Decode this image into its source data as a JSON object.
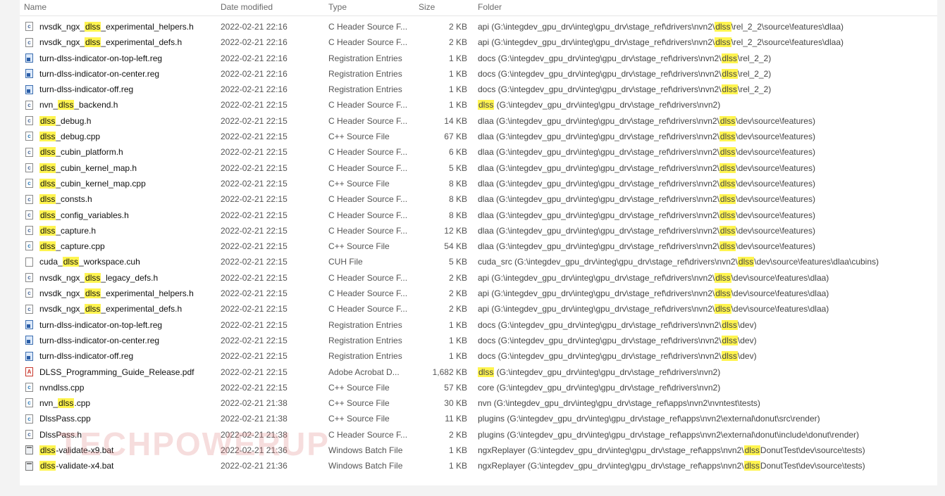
{
  "columns": {
    "name": "Name",
    "date": "Date modified",
    "type": "Type",
    "size": "Size",
    "folder": "Folder"
  },
  "highlight_color": "#fff44f",
  "watermark": "TECHPOWERUP",
  "rows": [
    {
      "icon": "h",
      "name_pre": "nvsdk_ngx_",
      "name_hl": "dlss",
      "name_post": "_experimental_helpers.h",
      "date": "2022-02-21 22:16",
      "type": "C Header Source F...",
      "size": "2 KB",
      "folder_pre": "api (G:\\integdev_gpu_drv\\integ\\gpu_drv\\stage_ref\\drivers\\nvn2\\",
      "folder_hl": "dlss",
      "folder_post": "\\rel_2_2\\source\\features\\dlaa)"
    },
    {
      "icon": "h",
      "name_pre": "nvsdk_ngx_",
      "name_hl": "dlss",
      "name_post": "_experimental_defs.h",
      "date": "2022-02-21 22:16",
      "type": "C Header Source F...",
      "size": "2 KB",
      "folder_pre": "api (G:\\integdev_gpu_drv\\integ\\gpu_drv\\stage_ref\\drivers\\nvn2\\",
      "folder_hl": "dlss",
      "folder_post": "\\rel_2_2\\source\\features\\dlaa)"
    },
    {
      "icon": "reg",
      "name_pre": "turn-dlss-indicator-on-top-left.reg",
      "name_hl": "",
      "name_post": "",
      "date": "2022-02-21 22:16",
      "type": "Registration Entries",
      "size": "1 KB",
      "folder_pre": "docs (G:\\integdev_gpu_drv\\integ\\gpu_drv\\stage_ref\\drivers\\nvn2\\",
      "folder_hl": "dlss",
      "folder_post": "\\rel_2_2)"
    },
    {
      "icon": "reg",
      "name_pre": "turn-dlss-indicator-on-center.reg",
      "name_hl": "",
      "name_post": "",
      "date": "2022-02-21 22:16",
      "type": "Registration Entries",
      "size": "1 KB",
      "folder_pre": "docs (G:\\integdev_gpu_drv\\integ\\gpu_drv\\stage_ref\\drivers\\nvn2\\",
      "folder_hl": "dlss",
      "folder_post": "\\rel_2_2)"
    },
    {
      "icon": "reg",
      "name_pre": "turn-dlss-indicator-off.reg",
      "name_hl": "",
      "name_post": "",
      "date": "2022-02-21 22:16",
      "type": "Registration Entries",
      "size": "1 KB",
      "folder_pre": "docs (G:\\integdev_gpu_drv\\integ\\gpu_drv\\stage_ref\\drivers\\nvn2\\",
      "folder_hl": "dlss",
      "folder_post": "\\rel_2_2)"
    },
    {
      "icon": "h",
      "name_pre": "nvn_",
      "name_hl": "dlss",
      "name_post": "_backend.h",
      "date": "2022-02-21 22:15",
      "type": "C Header Source F...",
      "size": "1 KB",
      "folder_pre": "",
      "folder_hl": "dlss",
      "folder_post": " (G:\\integdev_gpu_drv\\integ\\gpu_drv\\stage_ref\\drivers\\nvn2)"
    },
    {
      "icon": "h",
      "name_pre": "",
      "name_hl": "dlss",
      "name_post": "_debug.h",
      "date": "2022-02-21 22:15",
      "type": "C Header Source F...",
      "size": "14 KB",
      "folder_pre": "dlaa (G:\\integdev_gpu_drv\\integ\\gpu_drv\\stage_ref\\drivers\\nvn2\\",
      "folder_hl": "dlss",
      "folder_post": "\\dev\\source\\features)"
    },
    {
      "icon": "cpp",
      "name_pre": "",
      "name_hl": "dlss",
      "name_post": "_debug.cpp",
      "date": "2022-02-21 22:15",
      "type": "C++ Source File",
      "size": "67 KB",
      "folder_pre": "dlaa (G:\\integdev_gpu_drv\\integ\\gpu_drv\\stage_ref\\drivers\\nvn2\\",
      "folder_hl": "dlss",
      "folder_post": "\\dev\\source\\features)"
    },
    {
      "icon": "h",
      "name_pre": "",
      "name_hl": "dlss",
      "name_post": "_cubin_platform.h",
      "date": "2022-02-21 22:15",
      "type": "C Header Source F...",
      "size": "6 KB",
      "folder_pre": "dlaa (G:\\integdev_gpu_drv\\integ\\gpu_drv\\stage_ref\\drivers\\nvn2\\",
      "folder_hl": "dlss",
      "folder_post": "\\dev\\source\\features)"
    },
    {
      "icon": "h",
      "name_pre": "",
      "name_hl": "dlss",
      "name_post": "_cubin_kernel_map.h",
      "date": "2022-02-21 22:15",
      "type": "C Header Source F...",
      "size": "5 KB",
      "folder_pre": "dlaa (G:\\integdev_gpu_drv\\integ\\gpu_drv\\stage_ref\\drivers\\nvn2\\",
      "folder_hl": "dlss",
      "folder_post": "\\dev\\source\\features)"
    },
    {
      "icon": "cpp",
      "name_pre": "",
      "name_hl": "dlss",
      "name_post": "_cubin_kernel_map.cpp",
      "date": "2022-02-21 22:15",
      "type": "C++ Source File",
      "size": "8 KB",
      "folder_pre": "dlaa (G:\\integdev_gpu_drv\\integ\\gpu_drv\\stage_ref\\drivers\\nvn2\\",
      "folder_hl": "dlss",
      "folder_post": "\\dev\\source\\features)"
    },
    {
      "icon": "h",
      "name_pre": "",
      "name_hl": "dlss",
      "name_post": "_consts.h",
      "date": "2022-02-21 22:15",
      "type": "C Header Source F...",
      "size": "8 KB",
      "folder_pre": "dlaa (G:\\integdev_gpu_drv\\integ\\gpu_drv\\stage_ref\\drivers\\nvn2\\",
      "folder_hl": "dlss",
      "folder_post": "\\dev\\source\\features)"
    },
    {
      "icon": "h",
      "name_pre": "",
      "name_hl": "dlss",
      "name_post": "_config_variables.h",
      "date": "2022-02-21 22:15",
      "type": "C Header Source F...",
      "size": "8 KB",
      "folder_pre": "dlaa (G:\\integdev_gpu_drv\\integ\\gpu_drv\\stage_ref\\drivers\\nvn2\\",
      "folder_hl": "dlss",
      "folder_post": "\\dev\\source\\features)"
    },
    {
      "icon": "h",
      "name_pre": "",
      "name_hl": "dlss",
      "name_post": "_capture.h",
      "date": "2022-02-21 22:15",
      "type": "C Header Source F...",
      "size": "12 KB",
      "folder_pre": "dlaa (G:\\integdev_gpu_drv\\integ\\gpu_drv\\stage_ref\\drivers\\nvn2\\",
      "folder_hl": "dlss",
      "folder_post": "\\dev\\source\\features)"
    },
    {
      "icon": "cpp",
      "name_pre": "",
      "name_hl": "dlss",
      "name_post": "_capture.cpp",
      "date": "2022-02-21 22:15",
      "type": "C++ Source File",
      "size": "54 KB",
      "folder_pre": "dlaa (G:\\integdev_gpu_drv\\integ\\gpu_drv\\stage_ref\\drivers\\nvn2\\",
      "folder_hl": "dlss",
      "folder_post": "\\dev\\source\\features)"
    },
    {
      "icon": "cuh",
      "name_pre": "cuda_",
      "name_hl": "dlss",
      "name_post": "_workspace.cuh",
      "date": "2022-02-21 22:15",
      "type": "CUH File",
      "size": "5 KB",
      "folder_pre": "cuda_src (G:\\integdev_gpu_drv\\integ\\gpu_drv\\stage_ref\\drivers\\nvn2\\",
      "folder_hl": "dlss",
      "folder_post": "\\dev\\source\\features\\dlaa\\cubins)"
    },
    {
      "icon": "h",
      "name_pre": "nvsdk_ngx_",
      "name_hl": "dlss",
      "name_post": "_legacy_defs.h",
      "date": "2022-02-21 22:15",
      "type": "C Header Source F...",
      "size": "2 KB",
      "folder_pre": "api (G:\\integdev_gpu_drv\\integ\\gpu_drv\\stage_ref\\drivers\\nvn2\\",
      "folder_hl": "dlss",
      "folder_post": "\\dev\\source\\features\\dlaa)"
    },
    {
      "icon": "h",
      "name_pre": "nvsdk_ngx_",
      "name_hl": "dlss",
      "name_post": "_experimental_helpers.h",
      "date": "2022-02-21 22:15",
      "type": "C Header Source F...",
      "size": "2 KB",
      "folder_pre": "api (G:\\integdev_gpu_drv\\integ\\gpu_drv\\stage_ref\\drivers\\nvn2\\",
      "folder_hl": "dlss",
      "folder_post": "\\dev\\source\\features\\dlaa)"
    },
    {
      "icon": "h",
      "name_pre": "nvsdk_ngx_",
      "name_hl": "dlss",
      "name_post": "_experimental_defs.h",
      "date": "2022-02-21 22:15",
      "type": "C Header Source F...",
      "size": "2 KB",
      "folder_pre": "api (G:\\integdev_gpu_drv\\integ\\gpu_drv\\stage_ref\\drivers\\nvn2\\",
      "folder_hl": "dlss",
      "folder_post": "\\dev\\source\\features\\dlaa)"
    },
    {
      "icon": "reg",
      "name_pre": "turn-dlss-indicator-on-top-left.reg",
      "name_hl": "",
      "name_post": "",
      "date": "2022-02-21 22:15",
      "type": "Registration Entries",
      "size": "1 KB",
      "folder_pre": "docs (G:\\integdev_gpu_drv\\integ\\gpu_drv\\stage_ref\\drivers\\nvn2\\",
      "folder_hl": "dlss",
      "folder_post": "\\dev)"
    },
    {
      "icon": "reg",
      "name_pre": "turn-dlss-indicator-on-center.reg",
      "name_hl": "",
      "name_post": "",
      "date": "2022-02-21 22:15",
      "type": "Registration Entries",
      "size": "1 KB",
      "folder_pre": "docs (G:\\integdev_gpu_drv\\integ\\gpu_drv\\stage_ref\\drivers\\nvn2\\",
      "folder_hl": "dlss",
      "folder_post": "\\dev)"
    },
    {
      "icon": "reg",
      "name_pre": "turn-dlss-indicator-off.reg",
      "name_hl": "",
      "name_post": "",
      "date": "2022-02-21 22:15",
      "type": "Registration Entries",
      "size": "1 KB",
      "folder_pre": "docs (G:\\integdev_gpu_drv\\integ\\gpu_drv\\stage_ref\\drivers\\nvn2\\",
      "folder_hl": "dlss",
      "folder_post": "\\dev)"
    },
    {
      "icon": "pdf",
      "name_pre": "DLSS_Programming_Guide_Release.pdf",
      "name_hl": "",
      "name_post": "",
      "date": "2022-02-21 22:15",
      "type": "Adobe Acrobat D...",
      "size": "1,682 KB",
      "folder_pre": "",
      "folder_hl": "dlss",
      "folder_post": " (G:\\integdev_gpu_drv\\integ\\gpu_drv\\stage_ref\\drivers\\nvn2)"
    },
    {
      "icon": "cpp",
      "name_pre": "nvndlss.cpp",
      "name_hl": "",
      "name_post": "",
      "date": "2022-02-21 22:15",
      "type": "C++ Source File",
      "size": "57 KB",
      "folder_pre": "core (G:\\integdev_gpu_drv\\integ\\gpu_drv\\stage_ref\\drivers\\nvn2)",
      "folder_hl": "",
      "folder_post": ""
    },
    {
      "icon": "cpp",
      "name_pre": "nvn_",
      "name_hl": "dlss",
      "name_post": ".cpp",
      "date": "2022-02-21 21:38",
      "type": "C++ Source File",
      "size": "30 KB",
      "folder_pre": "nvn (G:\\integdev_gpu_drv\\integ\\gpu_drv\\stage_ref\\apps\\nvn2\\nvntest\\tests)",
      "folder_hl": "",
      "folder_post": ""
    },
    {
      "icon": "cpp",
      "name_pre": "DlssPass.cpp",
      "name_hl": "",
      "name_post": "",
      "date": "2022-02-21 21:38",
      "type": "C++ Source File",
      "size": "11 KB",
      "folder_pre": "plugins (G:\\integdev_gpu_drv\\integ\\gpu_drv\\stage_ref\\apps\\nvn2\\external\\donut\\src\\render)",
      "folder_hl": "",
      "folder_post": ""
    },
    {
      "icon": "h",
      "name_pre": "DlssPass.h",
      "name_hl": "",
      "name_post": "",
      "date": "2022-02-21 21:38",
      "type": "C Header Source F...",
      "size": "2 KB",
      "folder_pre": "plugins (G:\\integdev_gpu_drv\\integ\\gpu_drv\\stage_ref\\apps\\nvn2\\external\\donut\\include\\donut\\render)",
      "folder_hl": "",
      "folder_post": ""
    },
    {
      "icon": "bat",
      "name_pre": "",
      "name_hl": "dlss",
      "name_post": "-validate-x9.bat",
      "date": "2022-02-21 21:36",
      "type": "Windows Batch File",
      "size": "1 KB",
      "folder_pre": "ngxReplayer (G:\\integdev_gpu_drv\\integ\\gpu_drv\\stage_ref\\apps\\nvn2\\",
      "folder_hl": "dlss",
      "folder_post": "DonutTest\\dev\\source\\tests)"
    },
    {
      "icon": "bat",
      "name_pre": "",
      "name_hl": "dlss",
      "name_post": "-validate-x4.bat",
      "date": "2022-02-21 21:36",
      "type": "Windows Batch File",
      "size": "1 KB",
      "folder_pre": "ngxReplayer (G:\\integdev_gpu_drv\\integ\\gpu_drv\\stage_ref\\apps\\nvn2\\",
      "folder_hl": "dlss",
      "folder_post": "DonutTest\\dev\\source\\tests)"
    }
  ]
}
